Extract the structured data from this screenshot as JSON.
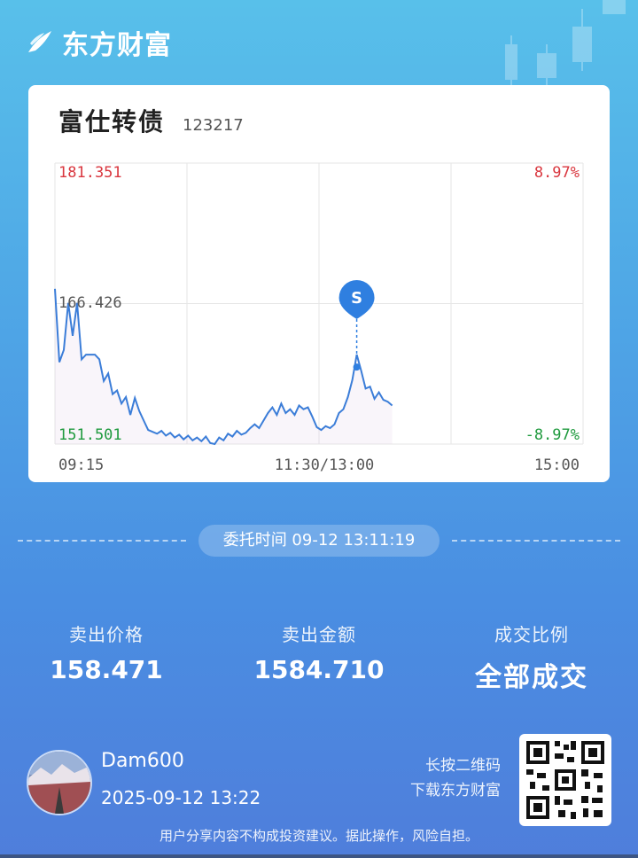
{
  "brand": {
    "name": "东方财富"
  },
  "card": {
    "bond_name": "富仕转债",
    "bond_code": "123217"
  },
  "chart_data": {
    "type": "line",
    "y_top_label": "181.351",
    "y_mid_label": "166.426",
    "y_bottom_label": "151.501",
    "pct_top_label": "8.97%",
    "pct_bottom_label": "-8.97%",
    "x_labels": [
      "09:15",
      "11:30/13:00",
      "15:00"
    ],
    "ylim": [
      151.501,
      181.351
    ],
    "base_price": 166.426,
    "series": [
      {
        "values": [
          168.0,
          160.2,
          161.5,
          166.5,
          163.0,
          166.5,
          160.5,
          161.0,
          161.0,
          161.0,
          160.5,
          158.2,
          159.0,
          156.8,
          157.2,
          155.8,
          156.5,
          154.6,
          156.4,
          155.0,
          154.0,
          153.0,
          152.8,
          152.6,
          152.9,
          152.4,
          152.7,
          152.2,
          152.5,
          152.0,
          152.4,
          151.9,
          152.2,
          151.8,
          152.3,
          151.6,
          151.5,
          152.2,
          151.9,
          152.6,
          152.3,
          152.9,
          152.5,
          152.7,
          153.2,
          153.6,
          153.2,
          154.0,
          154.8,
          155.4,
          154.6,
          155.8,
          154.8,
          155.2,
          154.6,
          155.6,
          155.2,
          155.4,
          154.4,
          153.3,
          153.0,
          153.4,
          153.2,
          153.6,
          154.8,
          155.2,
          156.5,
          158.3,
          161.0,
          159.3,
          157.4,
          157.6,
          156.3,
          157.0,
          156.2,
          156.0,
          155.6
        ]
      }
    ],
    "sell_marker": {
      "label": "S",
      "index": 68
    }
  },
  "order": {
    "label": "委托时间 09-12 13:11:19"
  },
  "stats": [
    {
      "label": "卖出价格",
      "value": "158.471"
    },
    {
      "label": "卖出金额",
      "value": "1584.710"
    },
    {
      "label": "成交比例",
      "value": "全部成交"
    }
  ],
  "user": {
    "name": "Dam600",
    "time": "2025-09-12 13:22"
  },
  "qr_tip": {
    "line1": "长按二维码",
    "line2": "下载东方财富"
  },
  "disclaimer": "用户分享内容不构成投资建议。据此操作，风险自担。",
  "colors": {
    "line": "#3b7dd8",
    "up": "#d9363e",
    "down": "#1f9a3e",
    "marker": "#2f7fe0"
  }
}
